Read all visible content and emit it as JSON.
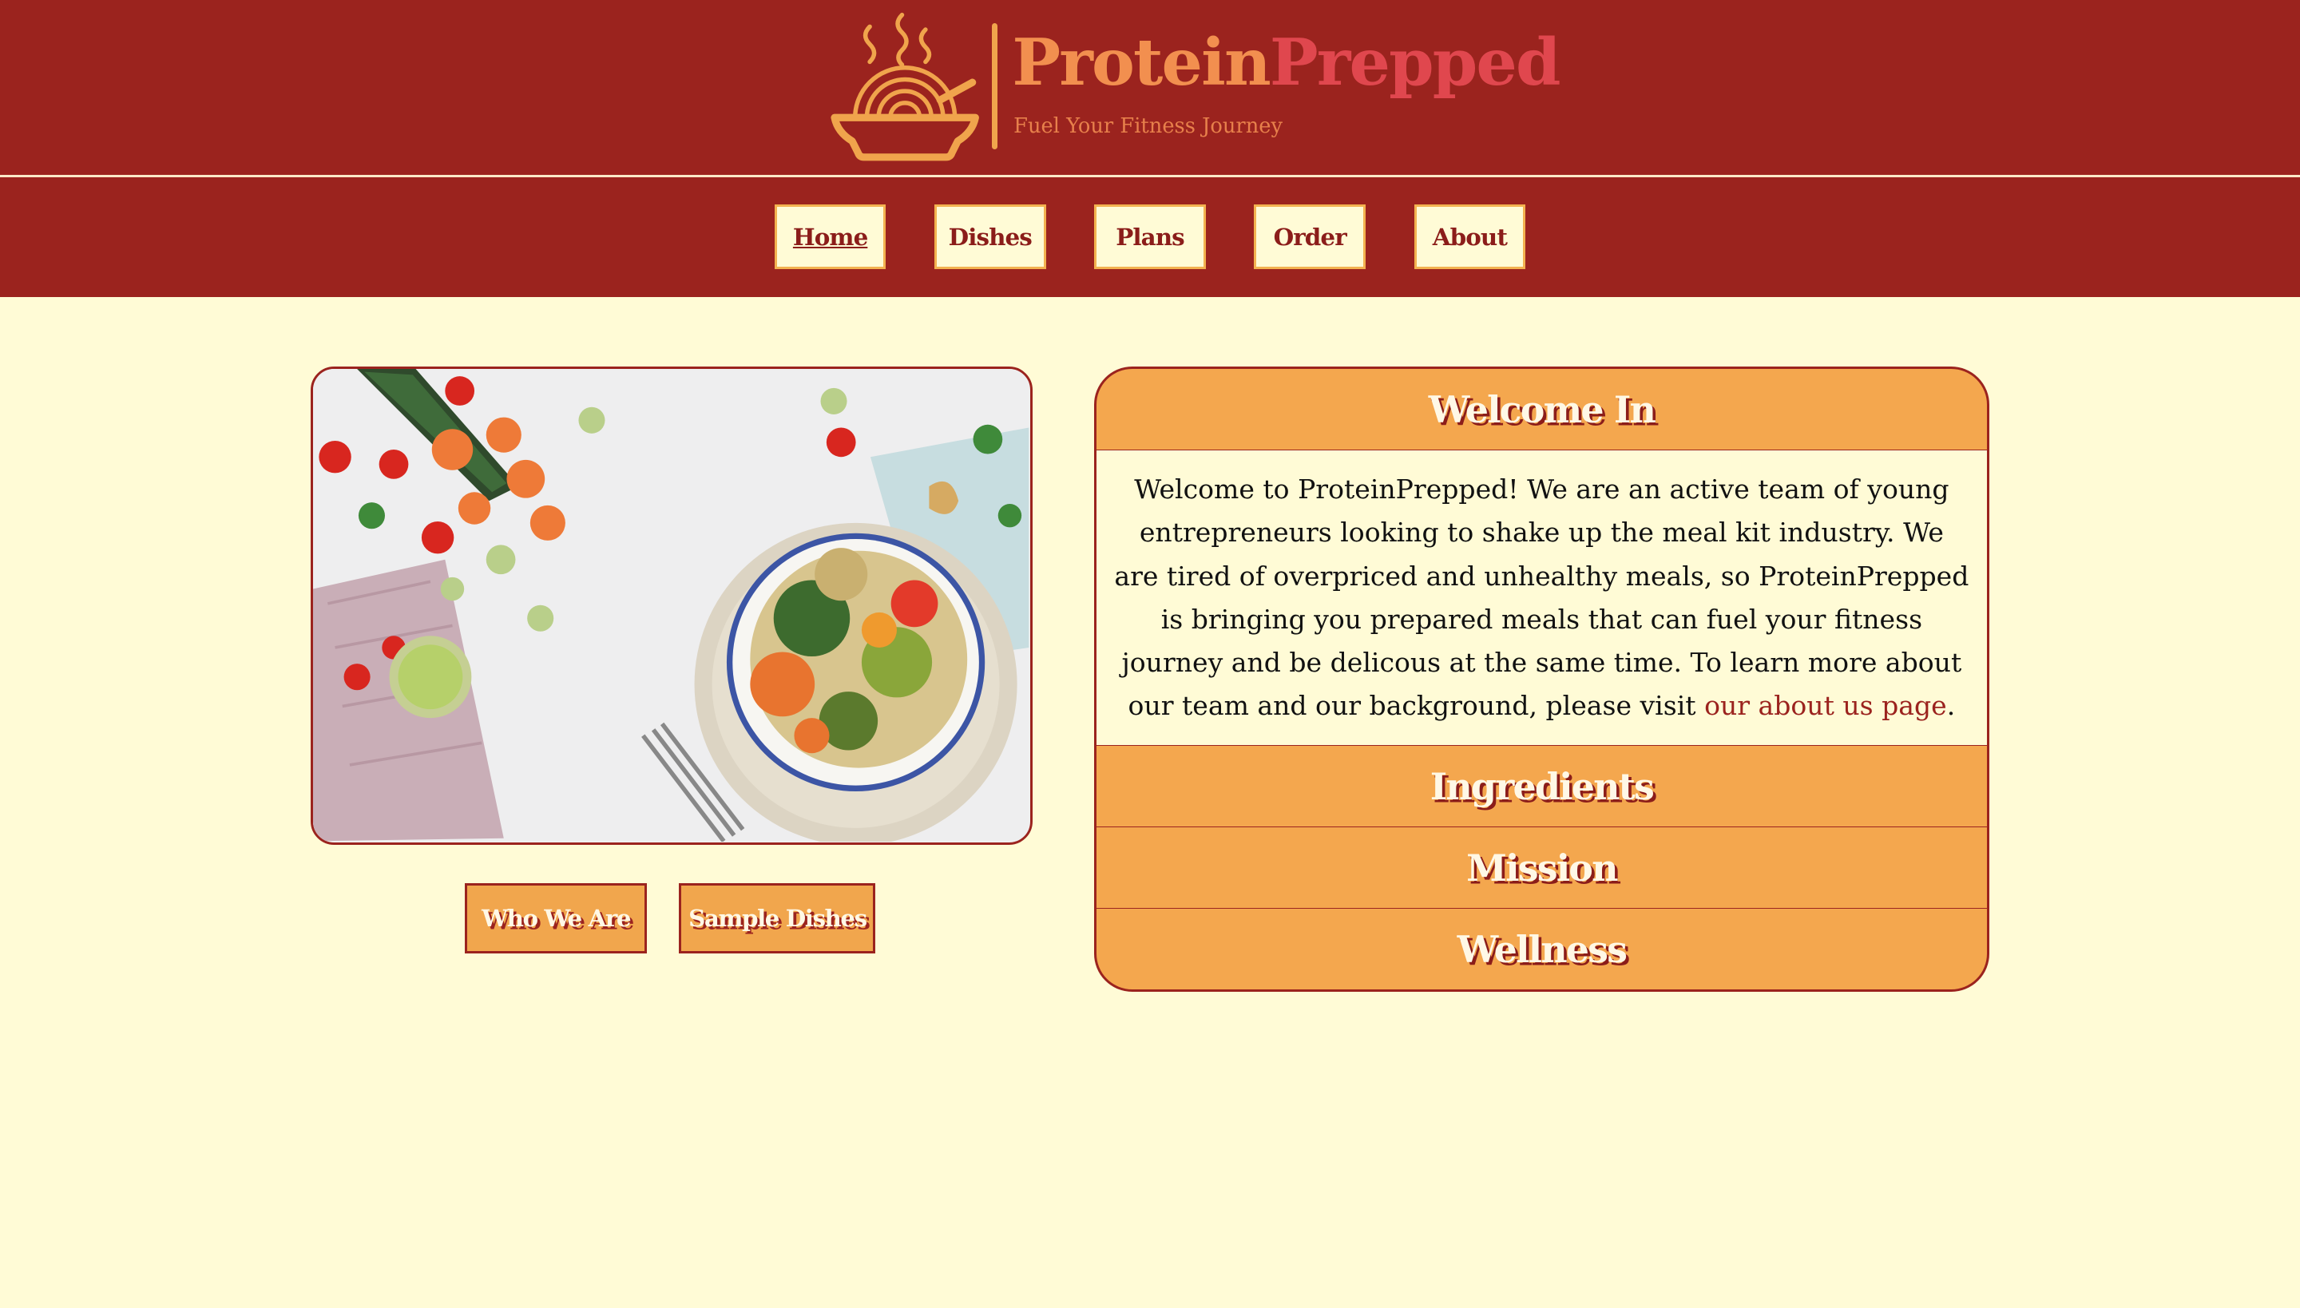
{
  "brand": {
    "name_part1": "Protein",
    "name_part2": "Prepped",
    "tagline": "Fuel Your Fitness Journey",
    "logo_icon": "noodle-bowl-icon"
  },
  "nav": {
    "items": [
      {
        "label": "Home",
        "active": true
      },
      {
        "label": "Dishes"
      },
      {
        "label": "Plans"
      },
      {
        "label": "Order"
      },
      {
        "label": "About"
      }
    ]
  },
  "hero": {
    "buttons": [
      "Who We Are",
      "Sample Dishes"
    ]
  },
  "accordion": {
    "sections": [
      {
        "title": "Welcome In"
      },
      {
        "title": "Ingredients"
      },
      {
        "title": "Mission"
      },
      {
        "title": "Wellness"
      }
    ],
    "welcome_text": "Welcome to ProteinPrepped! We are an active team of young entrepreneurs looking to shake up the meal kit industry. We are tired of overpriced and unhealthy meals, so ProteinPrepped is bringing you prepared meals that can fuel your fitness journey and be delicous at the same time. To learn more about our team and our background, please visit ",
    "link_text": "our about us page",
    "after_link": "."
  },
  "colors": {
    "header_bg": "#9b231e",
    "page_bg": "#fffbd6",
    "accent_orange": "#f4a74e",
    "brand_orange": "#f28f4f",
    "brand_red": "#e0474e"
  }
}
